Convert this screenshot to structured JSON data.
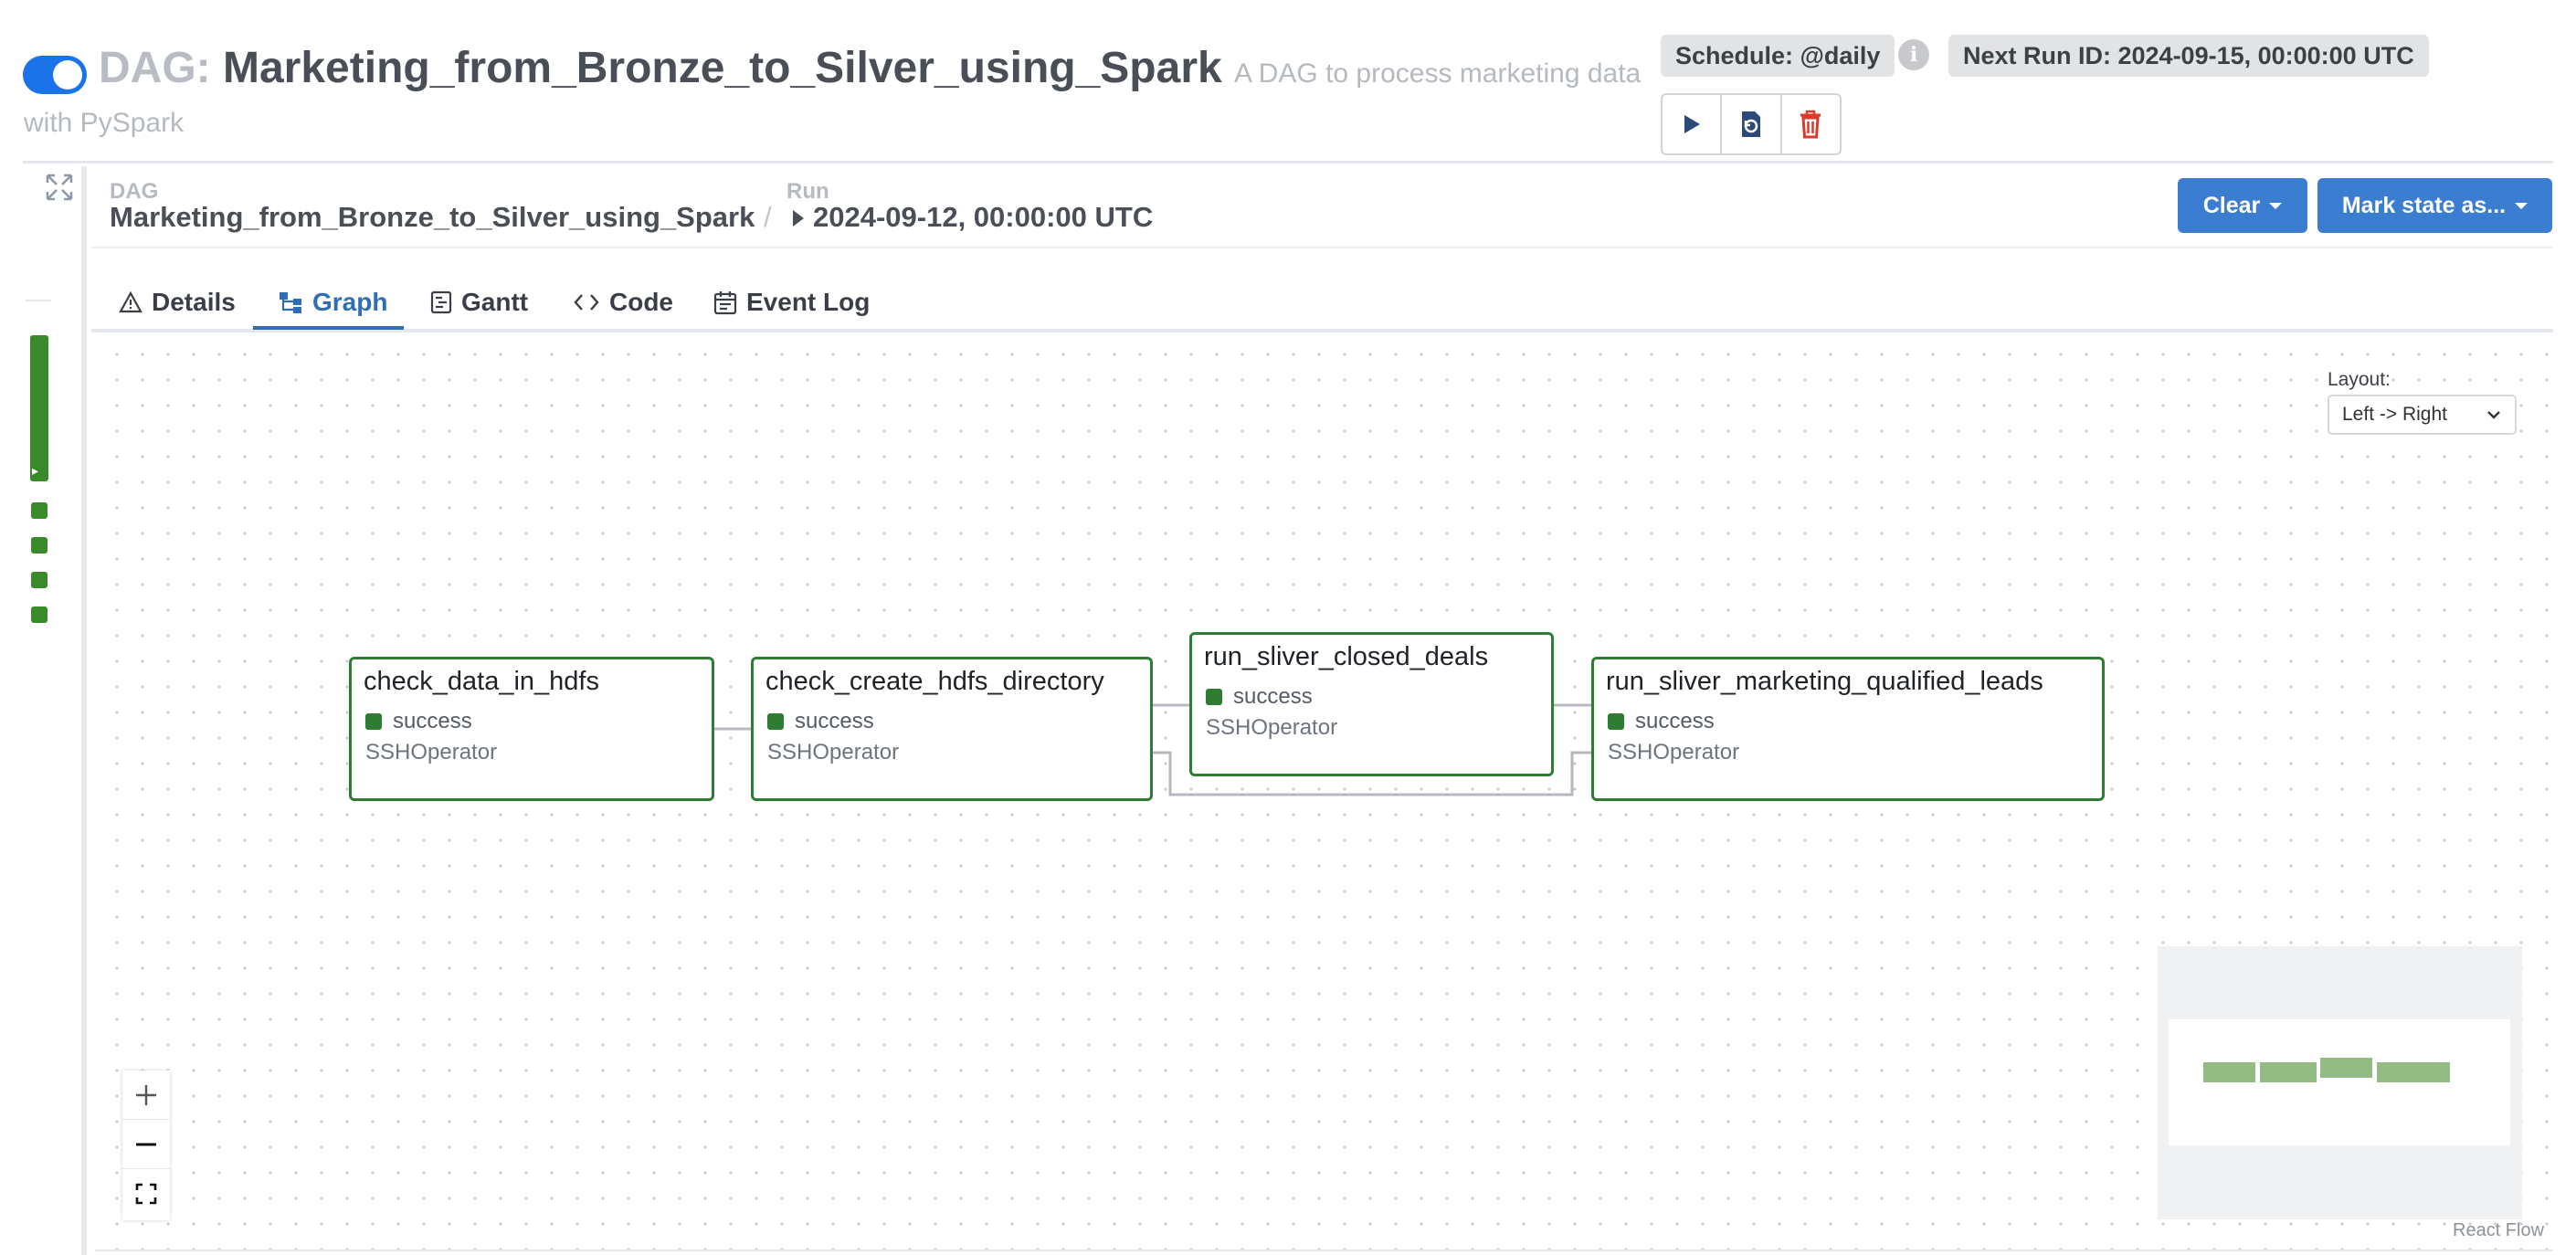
{
  "header": {
    "dag_prefix": "DAG:",
    "dag_id": "Marketing_from_Bronze_to_Silver_using_Spark",
    "description_part1": "A DAG to process marketing data",
    "description_part2": "with PySpark",
    "schedule": "Schedule: @daily",
    "next_run": "Next Run ID: 2024-09-15, 00:00:00 UTC",
    "paused": false
  },
  "breadcrumb": {
    "dag_label": "DAG",
    "dag_value": "Marketing_from_Bronze_to_Silver_using_Spark",
    "separator": "/",
    "run_label": "Run",
    "run_value": "2024-09-12, 00:00:00 UTC"
  },
  "actions": {
    "clear": "Clear",
    "mark_state": "Mark state as..."
  },
  "tabs": [
    {
      "label": "Details",
      "icon": "warning-triangle-icon",
      "active": false
    },
    {
      "label": "Graph",
      "icon": "graph-icon",
      "active": true
    },
    {
      "label": "Gantt",
      "icon": "gantt-icon",
      "active": false
    },
    {
      "label": "Code",
      "icon": "code-icon",
      "active": false
    },
    {
      "label": "Event Log",
      "icon": "calendar-icon",
      "active": false
    }
  ],
  "graph": {
    "layout_label": "Layout:",
    "layout_value": "Left -> Right",
    "nodes": [
      {
        "name": "check_data_in_hdfs",
        "state": "success",
        "operator": "SSHOperator"
      },
      {
        "name": "check_create_hdfs_directory",
        "state": "success",
        "operator": "SSHOperator"
      },
      {
        "name": "run_sliver_closed_deals",
        "state": "success",
        "operator": "SSHOperator"
      },
      {
        "name": "run_sliver_marketing_qualified_leads",
        "state": "success",
        "operator": "SSHOperator"
      }
    ],
    "footer_label": "React Flow"
  },
  "colors": {
    "success": "#2e7d32",
    "accent": "#3b7dd1",
    "toggle": "#1a73e8"
  }
}
